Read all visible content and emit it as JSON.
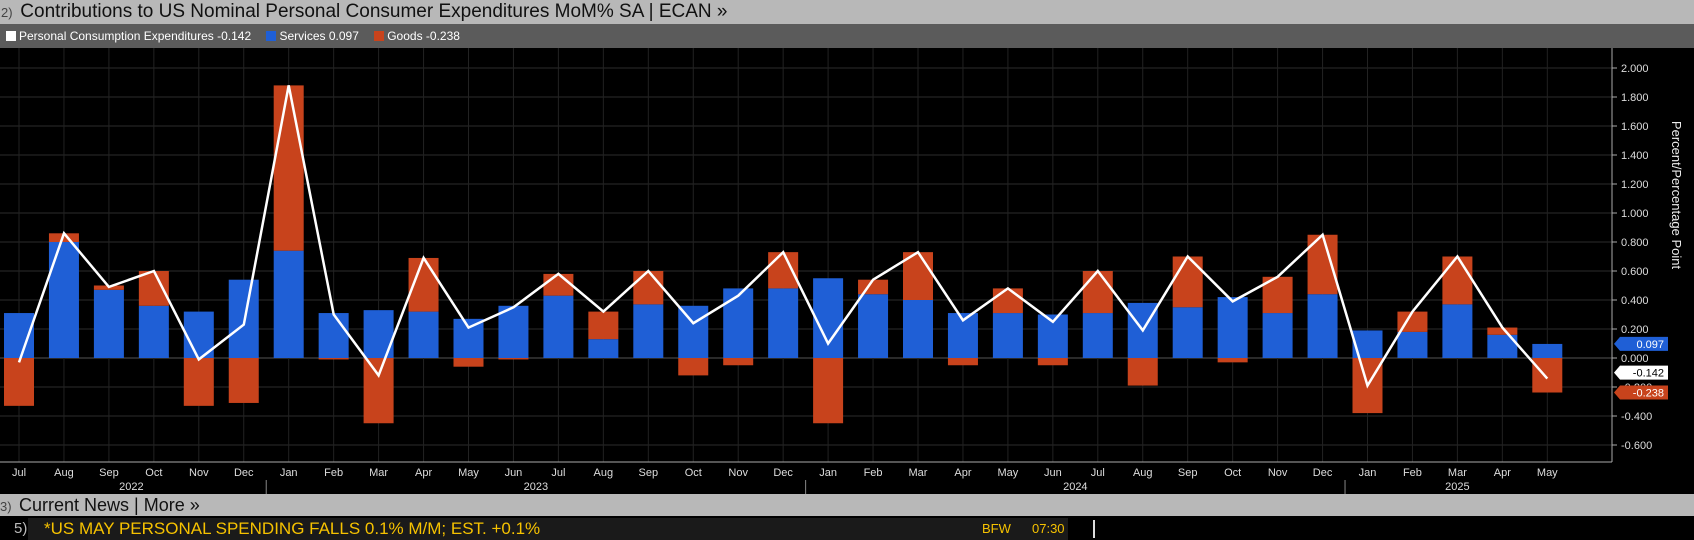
{
  "header": {
    "panel_number": "2)",
    "title": "Contributions to US Nominal Personal Consumer Expenditures MoM% SA | ECAN »"
  },
  "legend": [
    {
      "label": "Personal Consumption Expenditures -0.142",
      "color": "#ffffff"
    },
    {
      "label": "Services 0.097",
      "color": "#1f5fd6"
    },
    {
      "label": "Goods -0.238",
      "color": "#c8431c"
    }
  ],
  "news": {
    "panel_number": "3)",
    "title": "Current News | More »",
    "row_index": "5)",
    "headline": "*US MAY PERSONAL SPENDING FALLS 0.1% M/M; EST. +0.1%",
    "source": "BFW",
    "time": "07:30"
  },
  "chart_data": {
    "type": "bar",
    "stacked": true,
    "ylabel": "Percent/Percentage Point",
    "ylim": [
      -0.7,
      2.1
    ],
    "yticks": [
      -0.6,
      -0.4,
      -0.2,
      0,
      0.2,
      0.4,
      0.6,
      0.8,
      1.0,
      1.2,
      1.4,
      1.6,
      1.8,
      2.0
    ],
    "ytick_labels": [
      "-0.600",
      "-0.400",
      "-0.200",
      "0.000",
      "0.200",
      "0.400",
      "0.600",
      "0.800",
      "1.000",
      "1.200",
      "1.400",
      "1.600",
      "1.800",
      "2.000"
    ],
    "categories": [
      "Jul",
      "Aug",
      "Sep",
      "Oct",
      "Nov",
      "Dec",
      "Jan",
      "Feb",
      "Mar",
      "Apr",
      "May",
      "Jun",
      "Jul",
      "Aug",
      "Sep",
      "Oct",
      "Nov",
      "Dec",
      "Jan",
      "Feb",
      "Mar",
      "Apr",
      "May",
      "Jun",
      "Jul",
      "Aug",
      "Sep",
      "Oct",
      "Nov",
      "Dec",
      "Jan",
      "Feb",
      "Mar",
      "Apr",
      "May"
    ],
    "years": [
      {
        "label": "2022",
        "start": 0,
        "end": 5
      },
      {
        "label": "2023",
        "start": 6,
        "end": 17
      },
      {
        "label": "2024",
        "start": 18,
        "end": 29
      },
      {
        "label": "2025",
        "start": 30,
        "end": 34
      }
    ],
    "grid": true,
    "series": [
      {
        "name": "Services",
        "color": "#1f5fd6",
        "values": [
          0.31,
          0.8,
          0.47,
          0.36,
          0.32,
          0.54,
          0.74,
          0.31,
          0.33,
          0.32,
          0.27,
          0.36,
          0.43,
          0.13,
          0.37,
          0.36,
          0.48,
          0.48,
          0.55,
          0.44,
          0.4,
          0.31,
          0.31,
          0.3,
          0.31,
          0.38,
          0.35,
          0.42,
          0.31,
          0.44,
          0.19,
          0.18,
          0.37,
          0.16,
          0.097
        ]
      },
      {
        "name": "Goods",
        "color": "#c8431c",
        "values": [
          -0.33,
          0.06,
          0.03,
          0.24,
          -0.33,
          -0.31,
          1.14,
          -0.01,
          -0.45,
          0.37,
          -0.06,
          -0.01,
          0.15,
          0.19,
          0.23,
          -0.12,
          -0.05,
          0.25,
          -0.45,
          0.1,
          0.33,
          -0.05,
          0.17,
          -0.05,
          0.29,
          -0.19,
          0.35,
          -0.03,
          0.25,
          0.41,
          -0.38,
          0.14,
          0.33,
          0.05,
          -0.238
        ]
      },
      {
        "name": "Personal Consumption Expenditures",
        "color": "#ffffff",
        "kind": "line",
        "values": [
          -0.03,
          0.86,
          0.49,
          0.6,
          -0.01,
          0.23,
          1.88,
          0.3,
          -0.12,
          0.69,
          0.21,
          0.35,
          0.58,
          0.32,
          0.6,
          0.24,
          0.43,
          0.73,
          0.1,
          0.54,
          0.73,
          0.26,
          0.48,
          0.25,
          0.6,
          0.19,
          0.7,
          0.39,
          0.56,
          0.85,
          -0.19,
          0.32,
          0.7,
          0.21,
          -0.142
        ]
      }
    ],
    "last_value_tags": [
      {
        "label": "0.097",
        "value": 0.097,
        "color": "#1f5fd6",
        "text_color": "#ffffff"
      },
      {
        "label": "-0.142",
        "value": -0.142,
        "color": "#ffffff",
        "text_color": "#000000"
      },
      {
        "label": "-0.238",
        "value": -0.238,
        "color": "#c8431c",
        "text_color": "#ffffff"
      }
    ]
  }
}
